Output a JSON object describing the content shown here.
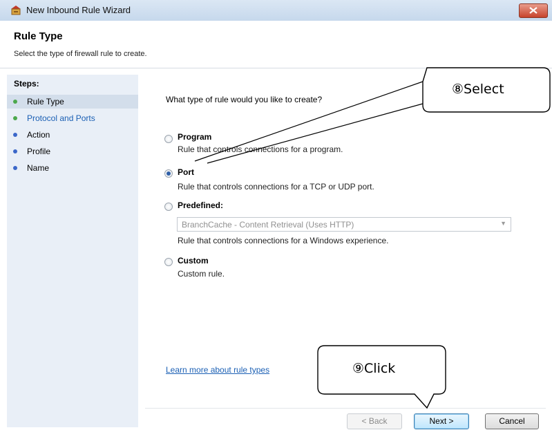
{
  "window": {
    "title": "New Inbound Rule Wizard",
    "close_icon": "close-x-icon"
  },
  "header": {
    "title": "Rule Type",
    "subtitle": "Select the type of firewall rule to create."
  },
  "steps": {
    "title": "Steps:",
    "items": [
      {
        "label": "Rule Type",
        "color": "#4ca84c"
      },
      {
        "label": "Protocol and Ports",
        "color": "#4ca84c"
      },
      {
        "label": "Action",
        "color": "#3b67c9"
      },
      {
        "label": "Profile",
        "color": "#3b67c9"
      },
      {
        "label": "Name",
        "color": "#3b67c9"
      }
    ]
  },
  "main": {
    "question": "What type of rule would you like to create?",
    "options": [
      {
        "label": "Program",
        "desc": "Rule that controls connections for a program.",
        "checked": false
      },
      {
        "label": "Port",
        "desc": "Rule that controls connections for a TCP or UDP port.",
        "checked": true
      },
      {
        "label": "Predefined:",
        "desc": "Rule that controls connections for a Windows experience.",
        "checked": false
      },
      {
        "label": "Custom",
        "desc": "Custom rule.",
        "checked": false
      }
    ],
    "predefined_value": "BranchCache - Content Retrieval (Uses HTTP)",
    "learn_more": "Learn more about rule types"
  },
  "buttons": {
    "back": "< Back",
    "next": "Next >",
    "cancel": "Cancel"
  },
  "callouts": {
    "select": "⑧Select",
    "click": "⑨Click"
  }
}
